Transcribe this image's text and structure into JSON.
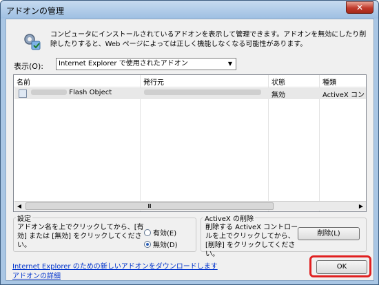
{
  "window": {
    "title": "アドオンの管理",
    "close_glyph": "✕"
  },
  "description": "コンピュータにインストールされているアドオンを表示して管理できます。アドオンを無効にしたり削除したりすると、Web ページによっては正しく機能しなくなる可能性があります。",
  "show": {
    "label": "表示(O):",
    "selected": "Internet Explorer で使用されたアドオン"
  },
  "list": {
    "columns": [
      "名前",
      "発行元",
      "状態",
      "種類"
    ],
    "rows": [
      {
        "name": "Flash Object",
        "publisher": "",
        "status": "無効",
        "type": "ActiveX コント"
      }
    ],
    "scroll_grip": "Ⅲ"
  },
  "settings": {
    "title": "設定",
    "text": "アドオン名を上でクリックしてから、[有効] または [無効] をクリックしてください。",
    "enable_label": "有効(E)",
    "disable_label": "無効(D)",
    "selected": "disable"
  },
  "activex_delete": {
    "title": "ActiveX の削除",
    "text": "削除する ActiveX コントロールを上でクリックしてから、[削除] をクリックしてください。",
    "delete_button": "削除(L)"
  },
  "links": {
    "download": "Internet Explorer のための新しいアドオンをダウンロードします",
    "details": "アドオンの詳細"
  },
  "ok_button": "OK",
  "colors": {
    "highlight": "#e02020",
    "link": "#0033cc"
  }
}
